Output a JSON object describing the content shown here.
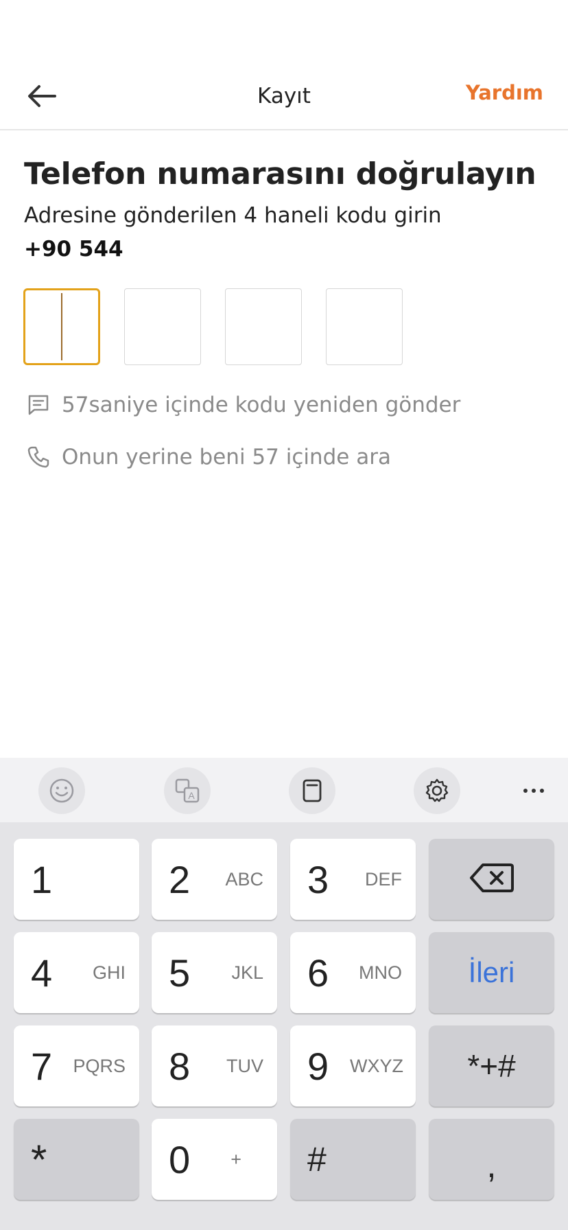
{
  "header": {
    "title": "Kayıt",
    "help_label": "Yardım"
  },
  "main": {
    "title": "Telefon numarasını doğrulayın",
    "subtitle": "Adresine gönderilen 4 haneli kodu girin",
    "phone": "+90 544",
    "resend_text": "57saniye içinde kodu yeniden gönder",
    "call_text": "Onun yerine beni 57 içinde ara"
  },
  "keyboard": {
    "toolbar": [
      "emoji-icon",
      "translate-icon",
      "clipboard-icon",
      "gear-icon",
      "more-icon"
    ],
    "keys": [
      {
        "num": "1",
        "sub": ""
      },
      {
        "num": "2",
        "sub": "ABC"
      },
      {
        "num": "3",
        "sub": "DEF"
      },
      {
        "num": "4",
        "sub": "GHI"
      },
      {
        "num": "5",
        "sub": "JKL"
      },
      {
        "num": "6",
        "sub": "MNO"
      },
      {
        "num": "7",
        "sub": "PQRS"
      },
      {
        "num": "8",
        "sub": "TUV"
      },
      {
        "num": "9",
        "sub": "WXYZ"
      },
      {
        "num": "0",
        "sub": "+"
      }
    ],
    "next_label": "İleri",
    "symbols_label": "*+#",
    "star_label": "*",
    "hash_label": "#",
    "comma_label": ","
  },
  "colors": {
    "accent": "#e8742c",
    "active_box": "#e3a21a",
    "next_blue": "#3b73d9"
  }
}
